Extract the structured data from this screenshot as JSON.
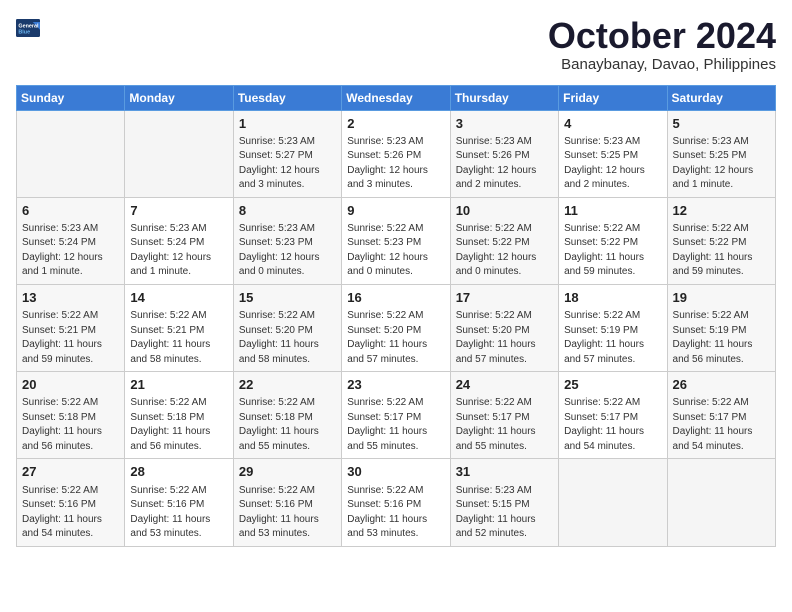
{
  "logo": {
    "general": "General",
    "blue": "Blue"
  },
  "header": {
    "month": "October 2024",
    "location": "Banaybanay, Davao, Philippines"
  },
  "weekdays": [
    "Sunday",
    "Monday",
    "Tuesday",
    "Wednesday",
    "Thursday",
    "Friday",
    "Saturday"
  ],
  "weeks": [
    [
      {
        "day": "",
        "info": ""
      },
      {
        "day": "",
        "info": ""
      },
      {
        "day": "1",
        "info": "Sunrise: 5:23 AM\nSunset: 5:27 PM\nDaylight: 12 hours\nand 3 minutes."
      },
      {
        "day": "2",
        "info": "Sunrise: 5:23 AM\nSunset: 5:26 PM\nDaylight: 12 hours\nand 3 minutes."
      },
      {
        "day": "3",
        "info": "Sunrise: 5:23 AM\nSunset: 5:26 PM\nDaylight: 12 hours\nand 2 minutes."
      },
      {
        "day": "4",
        "info": "Sunrise: 5:23 AM\nSunset: 5:25 PM\nDaylight: 12 hours\nand 2 minutes."
      },
      {
        "day": "5",
        "info": "Sunrise: 5:23 AM\nSunset: 5:25 PM\nDaylight: 12 hours\nand 1 minute."
      }
    ],
    [
      {
        "day": "6",
        "info": "Sunrise: 5:23 AM\nSunset: 5:24 PM\nDaylight: 12 hours\nand 1 minute."
      },
      {
        "day": "7",
        "info": "Sunrise: 5:23 AM\nSunset: 5:24 PM\nDaylight: 12 hours\nand 1 minute."
      },
      {
        "day": "8",
        "info": "Sunrise: 5:23 AM\nSunset: 5:23 PM\nDaylight: 12 hours\nand 0 minutes."
      },
      {
        "day": "9",
        "info": "Sunrise: 5:22 AM\nSunset: 5:23 PM\nDaylight: 12 hours\nand 0 minutes."
      },
      {
        "day": "10",
        "info": "Sunrise: 5:22 AM\nSunset: 5:22 PM\nDaylight: 12 hours\nand 0 minutes."
      },
      {
        "day": "11",
        "info": "Sunrise: 5:22 AM\nSunset: 5:22 PM\nDaylight: 11 hours\nand 59 minutes."
      },
      {
        "day": "12",
        "info": "Sunrise: 5:22 AM\nSunset: 5:22 PM\nDaylight: 11 hours\nand 59 minutes."
      }
    ],
    [
      {
        "day": "13",
        "info": "Sunrise: 5:22 AM\nSunset: 5:21 PM\nDaylight: 11 hours\nand 59 minutes."
      },
      {
        "day": "14",
        "info": "Sunrise: 5:22 AM\nSunset: 5:21 PM\nDaylight: 11 hours\nand 58 minutes."
      },
      {
        "day": "15",
        "info": "Sunrise: 5:22 AM\nSunset: 5:20 PM\nDaylight: 11 hours\nand 58 minutes."
      },
      {
        "day": "16",
        "info": "Sunrise: 5:22 AM\nSunset: 5:20 PM\nDaylight: 11 hours\nand 57 minutes."
      },
      {
        "day": "17",
        "info": "Sunrise: 5:22 AM\nSunset: 5:20 PM\nDaylight: 11 hours\nand 57 minutes."
      },
      {
        "day": "18",
        "info": "Sunrise: 5:22 AM\nSunset: 5:19 PM\nDaylight: 11 hours\nand 57 minutes."
      },
      {
        "day": "19",
        "info": "Sunrise: 5:22 AM\nSunset: 5:19 PM\nDaylight: 11 hours\nand 56 minutes."
      }
    ],
    [
      {
        "day": "20",
        "info": "Sunrise: 5:22 AM\nSunset: 5:18 PM\nDaylight: 11 hours\nand 56 minutes."
      },
      {
        "day": "21",
        "info": "Sunrise: 5:22 AM\nSunset: 5:18 PM\nDaylight: 11 hours\nand 56 minutes."
      },
      {
        "day": "22",
        "info": "Sunrise: 5:22 AM\nSunset: 5:18 PM\nDaylight: 11 hours\nand 55 minutes."
      },
      {
        "day": "23",
        "info": "Sunrise: 5:22 AM\nSunset: 5:17 PM\nDaylight: 11 hours\nand 55 minutes."
      },
      {
        "day": "24",
        "info": "Sunrise: 5:22 AM\nSunset: 5:17 PM\nDaylight: 11 hours\nand 55 minutes."
      },
      {
        "day": "25",
        "info": "Sunrise: 5:22 AM\nSunset: 5:17 PM\nDaylight: 11 hours\nand 54 minutes."
      },
      {
        "day": "26",
        "info": "Sunrise: 5:22 AM\nSunset: 5:17 PM\nDaylight: 11 hours\nand 54 minutes."
      }
    ],
    [
      {
        "day": "27",
        "info": "Sunrise: 5:22 AM\nSunset: 5:16 PM\nDaylight: 11 hours\nand 54 minutes."
      },
      {
        "day": "28",
        "info": "Sunrise: 5:22 AM\nSunset: 5:16 PM\nDaylight: 11 hours\nand 53 minutes."
      },
      {
        "day": "29",
        "info": "Sunrise: 5:22 AM\nSunset: 5:16 PM\nDaylight: 11 hours\nand 53 minutes."
      },
      {
        "day": "30",
        "info": "Sunrise: 5:22 AM\nSunset: 5:16 PM\nDaylight: 11 hours\nand 53 minutes."
      },
      {
        "day": "31",
        "info": "Sunrise: 5:23 AM\nSunset: 5:15 PM\nDaylight: 11 hours\nand 52 minutes."
      },
      {
        "day": "",
        "info": ""
      },
      {
        "day": "",
        "info": ""
      }
    ]
  ]
}
